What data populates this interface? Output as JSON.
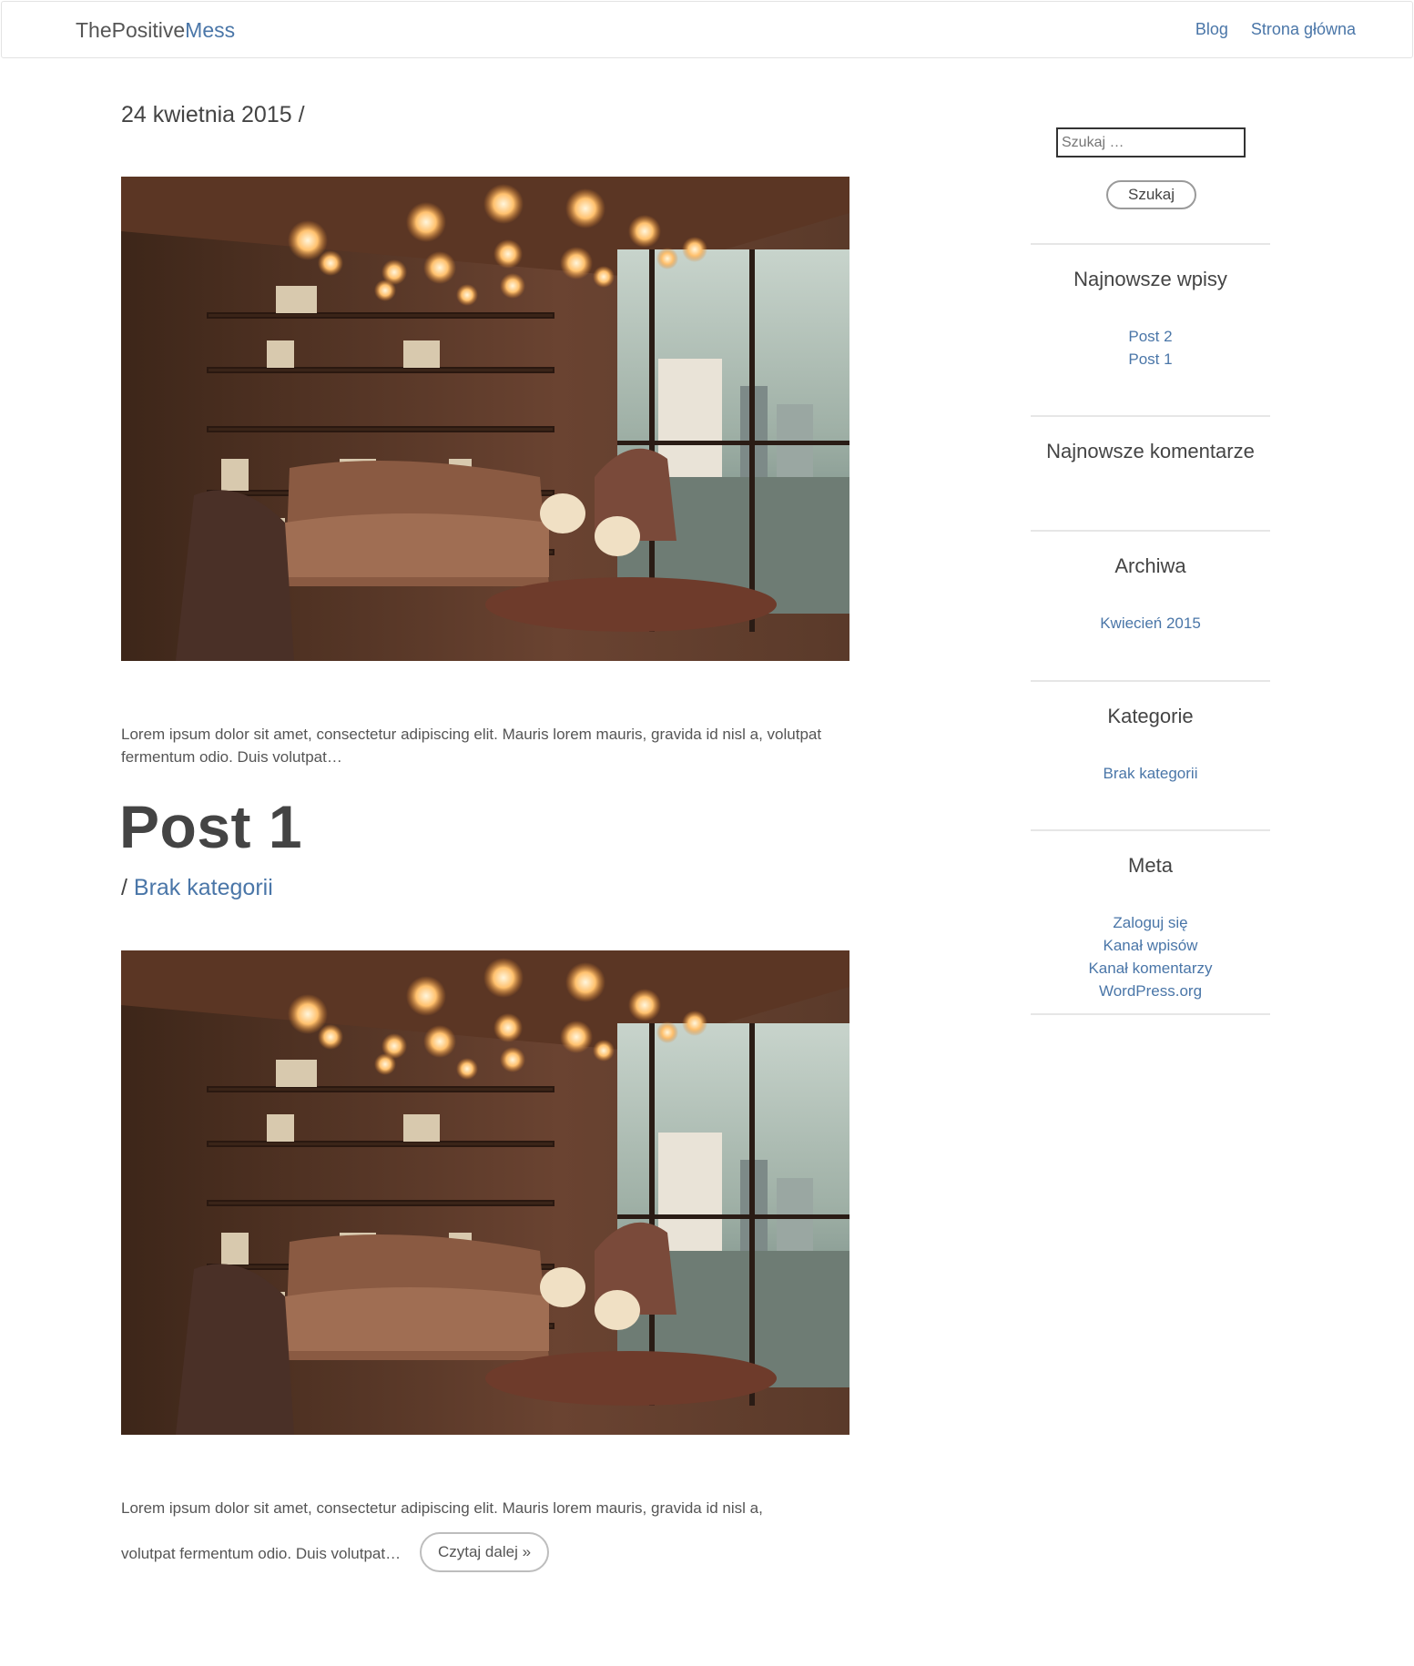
{
  "header": {
    "brand_part1": "ThePositive",
    "brand_part2": "Mess",
    "nav": [
      "Blog",
      "Strona główna"
    ]
  },
  "main": {
    "date_line": "24 kwietnia 2015 /",
    "excerpt_1": "Lorem ipsum dolor sit amet, consectetur adipiscing elit. Mauris lorem mauris, gravida id nisl a, volutpat fermentum odio. Duis volutpat…",
    "post_title": "Post 1",
    "post_cat_prefix": "/ ",
    "post_category": "Brak kategorii",
    "excerpt_2_line1": "Lorem ipsum dolor sit amet, consectetur adipiscing elit. Mauris lorem mauris, gravida id nisl a,",
    "excerpt_2_line2": "volutpat fermentum odio. Duis volutpat…",
    "read_more": "Czytaj dalej »"
  },
  "sidebar": {
    "search_placeholder": "Szukaj …",
    "search_button": "Szukaj",
    "recent_posts": {
      "title": "Najnowsze wpisy",
      "items": [
        "Post 2",
        "Post 1"
      ]
    },
    "recent_comments": {
      "title": "Najnowsze komentarze"
    },
    "archives": {
      "title": "Archiwa",
      "items": [
        "Kwiecień 2015"
      ]
    },
    "categories": {
      "title": "Kategorie",
      "items": [
        "Brak kategorii"
      ]
    },
    "meta": {
      "title": "Meta",
      "items": [
        "Zaloguj się",
        "Kanał wpisów",
        "Kanał komentarzy",
        "WordPress.org"
      ]
    }
  },
  "colors": {
    "link": "#4a76a8",
    "text": "#444444"
  }
}
